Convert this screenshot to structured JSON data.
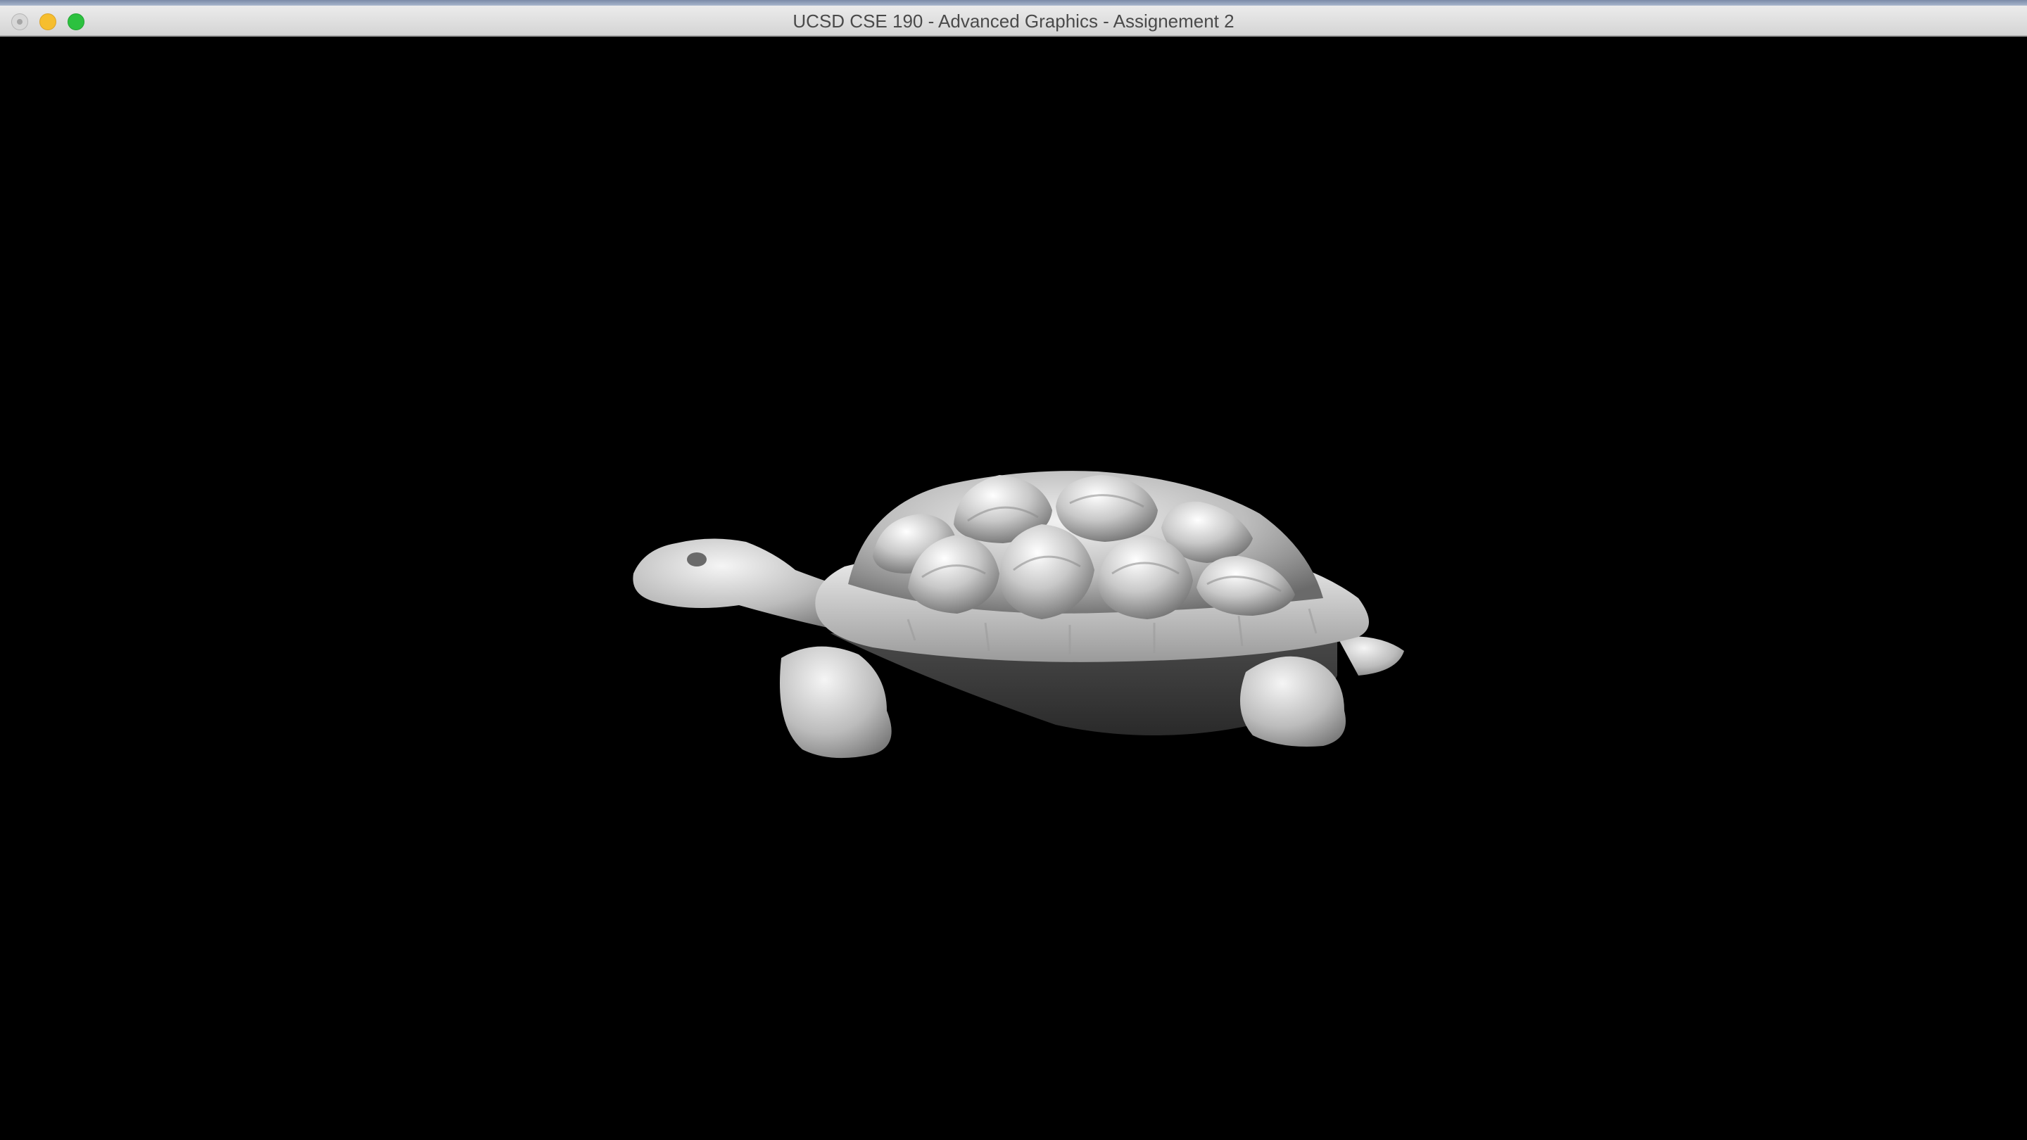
{
  "window": {
    "title": "UCSD CSE 190 - Advanced Graphics - Assignement 2",
    "controls": {
      "close": "close-button",
      "minimize": "minimize-button",
      "maximize": "maximize-button"
    },
    "traffic_colors": {
      "close": "#d8d8d8",
      "minimize": "#f6be2e",
      "maximize": "#2cc13f"
    }
  },
  "viewport": {
    "background": "#000000",
    "model": "turtle-model"
  }
}
